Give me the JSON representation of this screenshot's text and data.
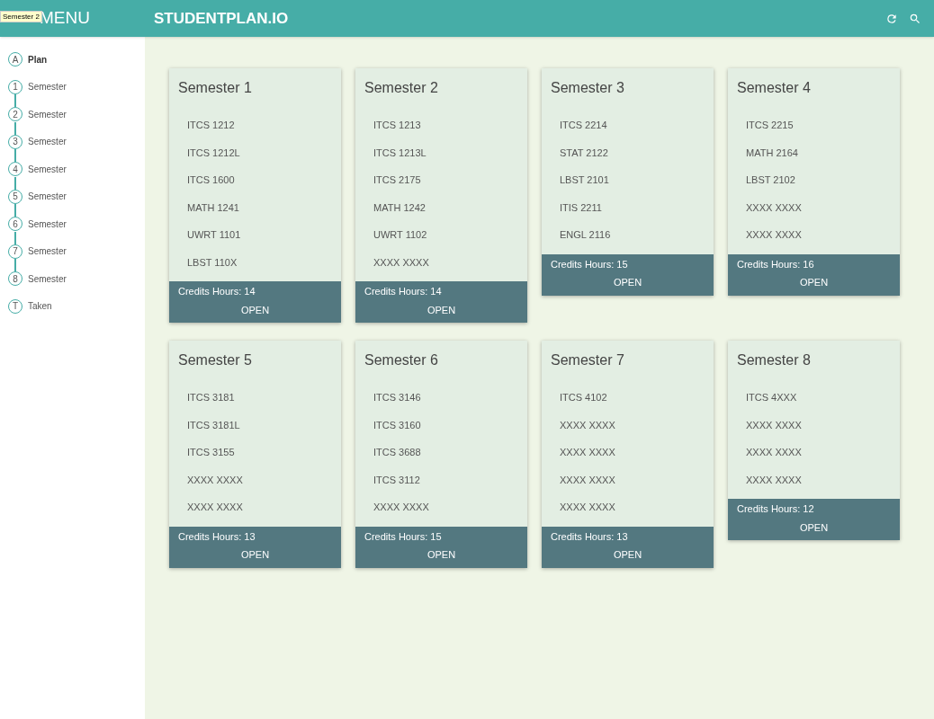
{
  "header": {
    "menu_title": "MENU",
    "tooltip": "Semester 2",
    "app_title": "STUDENTPLAN.IO"
  },
  "sidebar": {
    "items": [
      {
        "kind": "section",
        "badge": "A",
        "label": "Plan",
        "selected": true
      },
      {
        "kind": "semester",
        "badge": "1",
        "label": "Semester",
        "selected": false
      },
      {
        "kind": "semester",
        "badge": "2",
        "label": "Semester",
        "selected": false
      },
      {
        "kind": "semester",
        "badge": "3",
        "label": "Semester",
        "selected": false
      },
      {
        "kind": "semester",
        "badge": "4",
        "label": "Semester",
        "selected": false
      },
      {
        "kind": "semester",
        "badge": "5",
        "label": "Semester",
        "selected": false
      },
      {
        "kind": "semester",
        "badge": "6",
        "label": "Semester",
        "selected": false
      },
      {
        "kind": "semester",
        "badge": "7",
        "label": "Semester",
        "selected": false
      },
      {
        "kind": "semester",
        "badge": "8",
        "label": "Semester",
        "selected": false
      },
      {
        "kind": "section",
        "badge": "T",
        "label": "Taken",
        "selected": false
      }
    ]
  },
  "semesters": [
    {
      "title": "Semester 1",
      "courses": [
        "ITCS 1212",
        "ITCS 1212L",
        "ITCS 1600",
        "MATH 1241",
        "UWRT 1101",
        "LBST 110X"
      ],
      "credits": "Credits Hours: 14",
      "action": "OPEN"
    },
    {
      "title": "Semester 2",
      "courses": [
        "ITCS 1213",
        "ITCS 1213L",
        "ITCS 2175",
        "MATH 1242",
        "UWRT 1102",
        "XXXX XXXX"
      ],
      "credits": "Credits Hours: 14",
      "action": "OPEN"
    },
    {
      "title": "Semester 3",
      "courses": [
        "ITCS 2214",
        "STAT 2122",
        "LBST 2101",
        "ITIS 2211",
        "ENGL 2116"
      ],
      "credits": "Credits Hours: 15",
      "action": "OPEN"
    },
    {
      "title": "Semester 4",
      "courses": [
        "ITCS 2215",
        "MATH 2164",
        "LBST 2102",
        "XXXX XXXX",
        "XXXX XXXX"
      ],
      "credits": "Credits Hours: 16",
      "action": "OPEN"
    },
    {
      "title": "Semester 5",
      "courses": [
        "ITCS 3181",
        "ITCS 3181L",
        "ITCS 3155",
        "XXXX XXXX",
        "XXXX XXXX"
      ],
      "credits": "Credits Hours: 13",
      "action": "OPEN"
    },
    {
      "title": "Semester 6",
      "courses": [
        "ITCS 3146",
        "ITCS 3160",
        "ITCS 3688",
        "ITCS 3112",
        "XXXX XXXX"
      ],
      "credits": "Credits Hours: 15",
      "action": "OPEN"
    },
    {
      "title": "Semester 7",
      "courses": [
        "ITCS 4102",
        "XXXX XXXX",
        "XXXX XXXX",
        "XXXX XXXX",
        "XXXX XXXX"
      ],
      "credits": "Credits Hours: 13",
      "action": "OPEN"
    },
    {
      "title": "Semester 8",
      "courses": [
        "ITCS 4XXX",
        "XXXX XXXX",
        "XXXX XXXX",
        "XXXX XXXX"
      ],
      "credits": "Credits Hours: 12",
      "action": "OPEN"
    }
  ]
}
